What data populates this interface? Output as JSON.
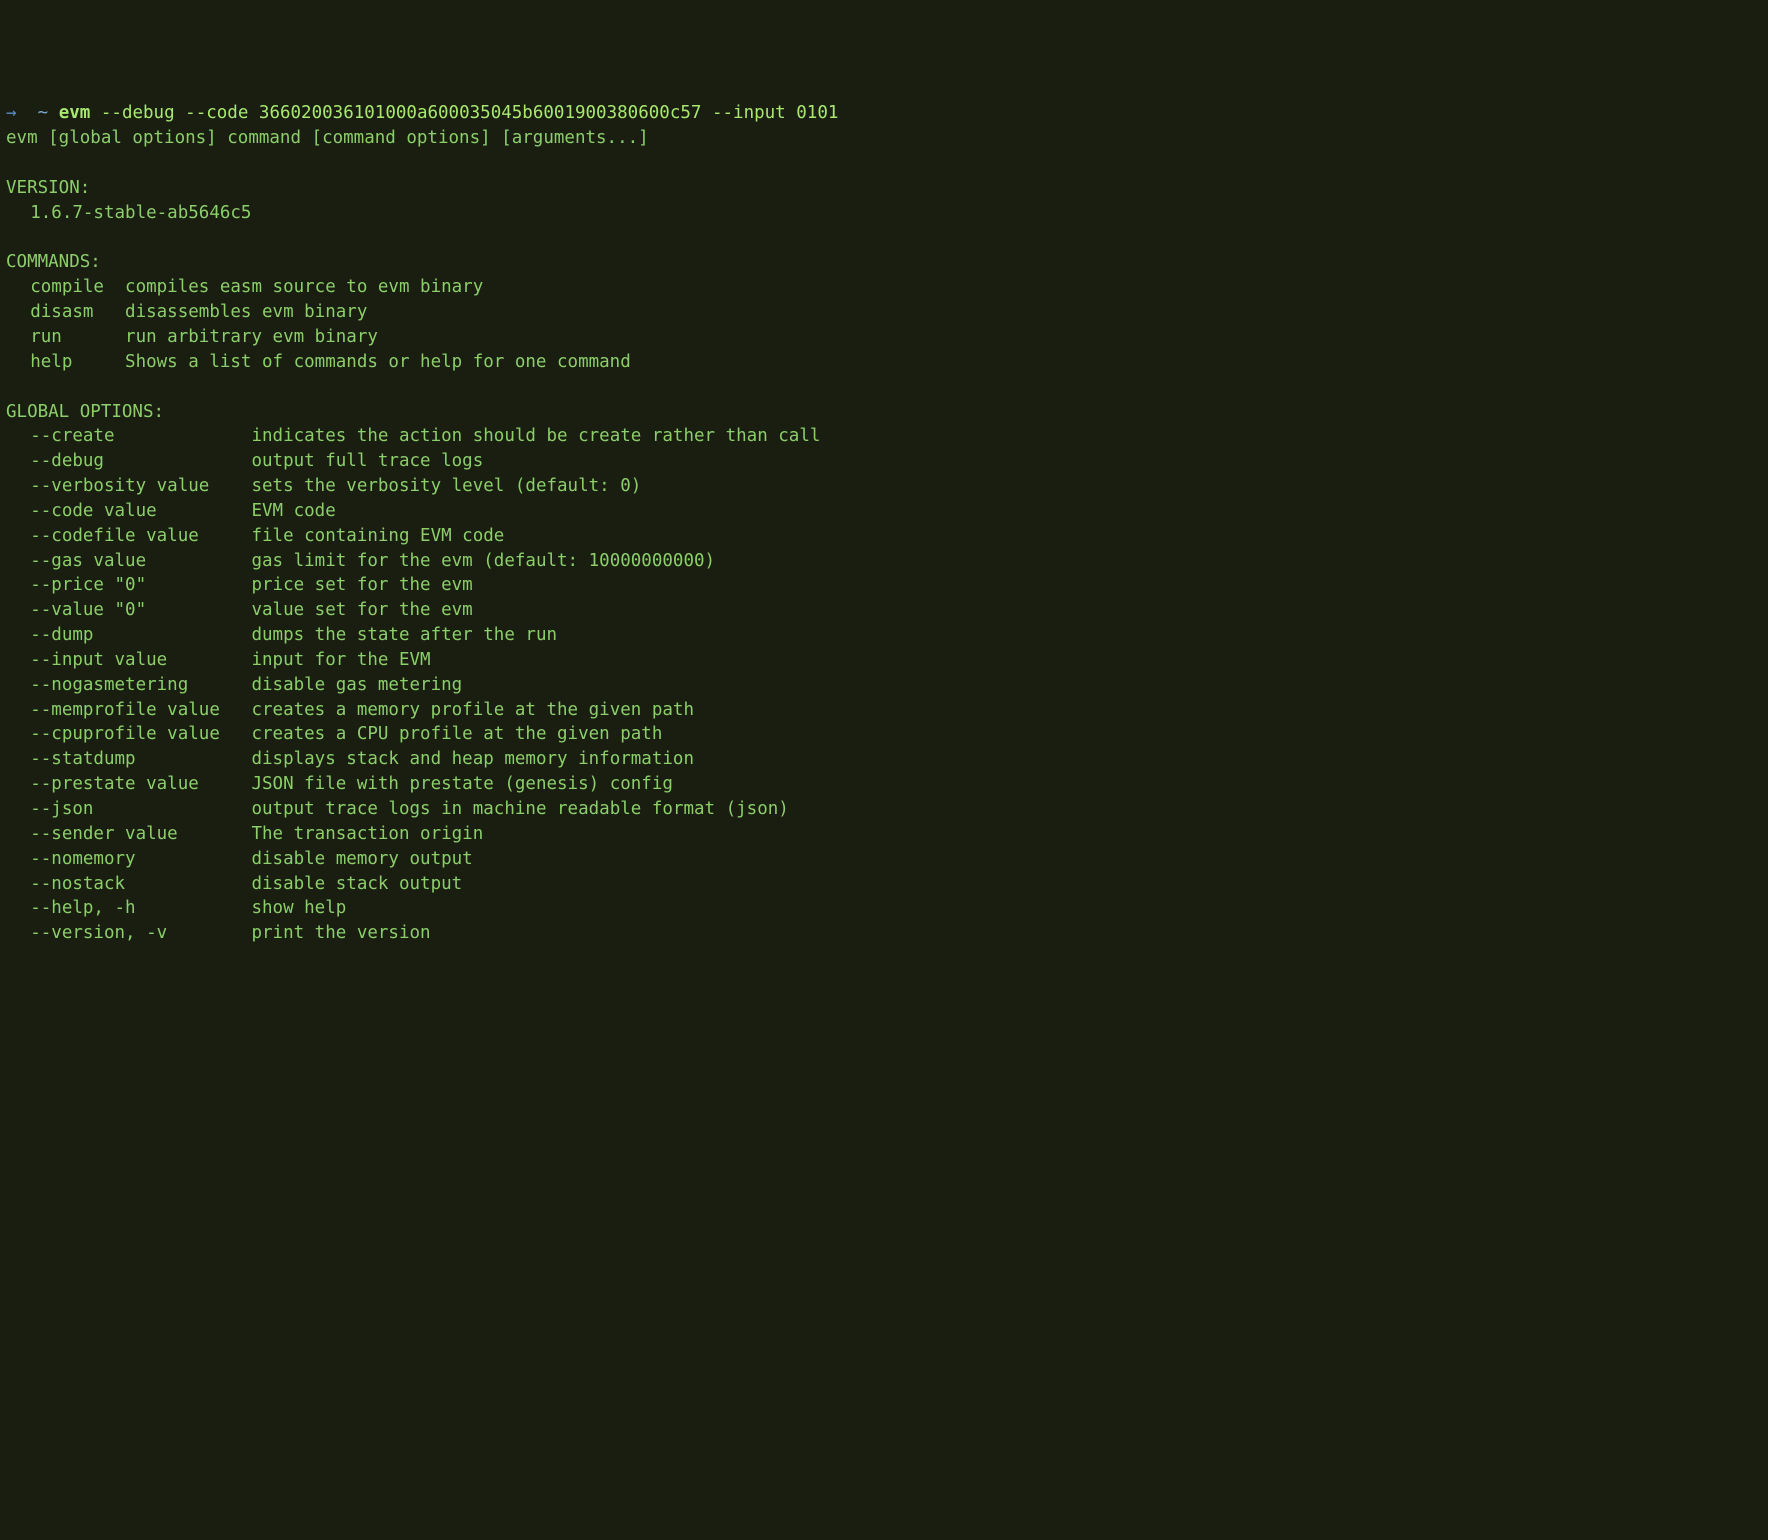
{
  "prompt": {
    "arrow": "→",
    "tilde": "~",
    "command": "evm",
    "args": "--debug --code 366020036101000a600035045b6001900380600c57 --input 0101"
  },
  "usage_line": "evm [global options] command [command options] [arguments...]",
  "version": {
    "header": "VERSION:",
    "value": "1.6.7-stable-ab5646c5"
  },
  "commands": {
    "header": "COMMANDS:",
    "items": [
      {
        "name": "compile",
        "desc": "compiles easm source to evm binary"
      },
      {
        "name": "disasm",
        "desc": "disassembles evm binary"
      },
      {
        "name": "run",
        "desc": "run arbitrary evm binary"
      },
      {
        "name": "help",
        "desc": "Shows a list of commands or help for one command"
      }
    ]
  },
  "global_options": {
    "header": "GLOBAL OPTIONS:",
    "items": [
      {
        "flag": "--create",
        "desc": "indicates the action should be create rather than call"
      },
      {
        "flag": "--debug",
        "desc": "output full trace logs"
      },
      {
        "flag": "--verbosity value",
        "desc": "sets the verbosity level (default: 0)"
      },
      {
        "flag": "--code value",
        "desc": "EVM code"
      },
      {
        "flag": "--codefile value",
        "desc": "file containing EVM code"
      },
      {
        "flag": "--gas value",
        "desc": "gas limit for the evm (default: 10000000000)"
      },
      {
        "flag": "--price \"0\"",
        "desc": "price set for the evm"
      },
      {
        "flag": "--value \"0\"",
        "desc": "value set for the evm"
      },
      {
        "flag": "--dump",
        "desc": "dumps the state after the run"
      },
      {
        "flag": "--input value",
        "desc": "input for the EVM"
      },
      {
        "flag": "--nogasmetering",
        "desc": "disable gas metering"
      },
      {
        "flag": "--memprofile value",
        "desc": "creates a memory profile at the given path"
      },
      {
        "flag": "--cpuprofile value",
        "desc": "creates a CPU profile at the given path"
      },
      {
        "flag": "--statdump",
        "desc": "displays stack and heap memory information"
      },
      {
        "flag": "--prestate value",
        "desc": "JSON file with prestate (genesis) config"
      },
      {
        "flag": "--json",
        "desc": "output trace logs in machine readable format (json)"
      },
      {
        "flag": "--sender value",
        "desc": "The transaction origin"
      },
      {
        "flag": "--nomemory",
        "desc": "disable memory output"
      },
      {
        "flag": "--nostack",
        "desc": "disable stack output"
      },
      {
        "flag": "--help, -h",
        "desc": "show help"
      },
      {
        "flag": "--version, -v",
        "desc": "print the version"
      }
    ]
  }
}
